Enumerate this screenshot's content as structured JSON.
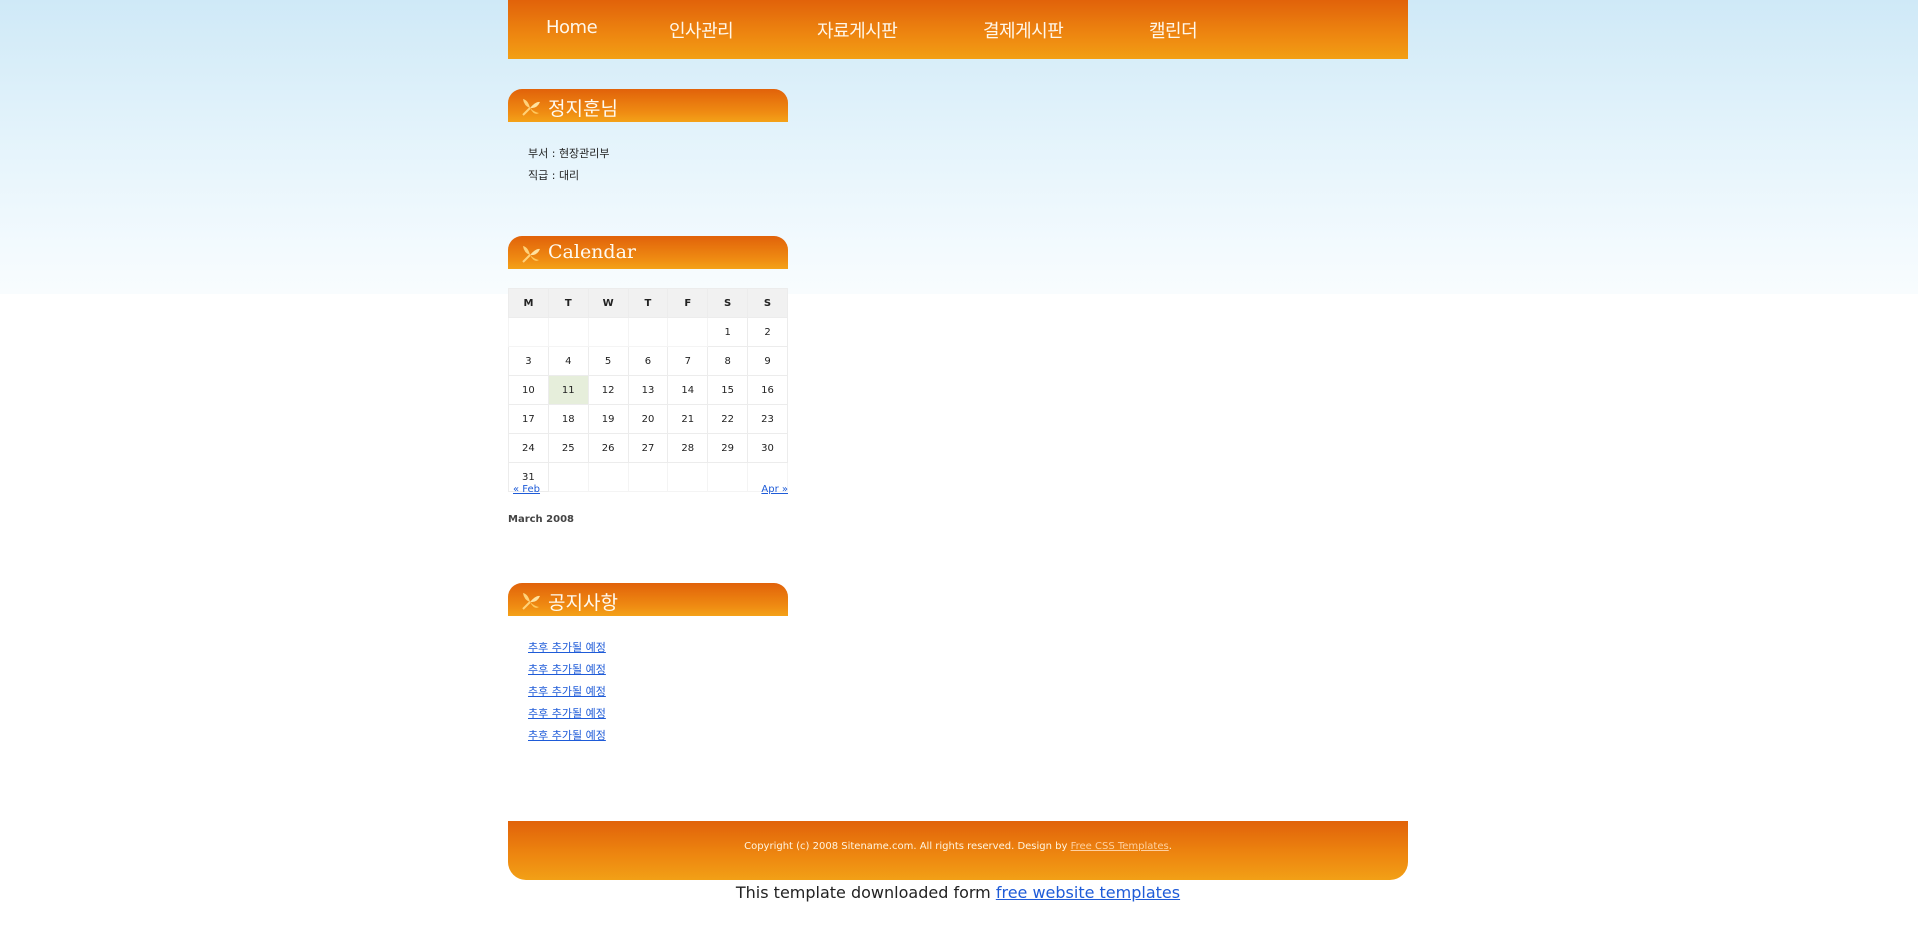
{
  "nav": {
    "items": [
      "Home",
      "인사관리",
      "자료게시판",
      "결제게시판",
      "캘린더"
    ]
  },
  "profile": {
    "title": "정지훈님",
    "department": "부서 : 현장관리부",
    "position": "직급 : 대리"
  },
  "calendar": {
    "title": "Calendar",
    "weekdays": [
      "M",
      "T",
      "W",
      "T",
      "F",
      "S",
      "S"
    ],
    "weeks": [
      [
        "",
        "",
        "",
        "",
        "",
        "1",
        "2"
      ],
      [
        "3",
        "4",
        "5",
        "6",
        "7",
        "8",
        "9"
      ],
      [
        "10",
        "11",
        "12",
        "13",
        "14",
        "15",
        "16"
      ],
      [
        "17",
        "18",
        "19",
        "20",
        "21",
        "22",
        "23"
      ],
      [
        "24",
        "25",
        "26",
        "27",
        "28",
        "29",
        "30"
      ],
      [
        "31",
        "",
        "",
        "",
        "",
        "",
        ""
      ]
    ],
    "highlighted_day": "11",
    "prev_label": "« Feb",
    "next_label": "Apr »",
    "caption": "March 2008"
  },
  "notice": {
    "title": "공지사항",
    "items": [
      "추후 추가될 예정",
      "추후 추가될 예정",
      "추후 추가될 예정",
      "추후 추가될 예정",
      "추후 추가될 예정"
    ]
  },
  "footer": {
    "copyright_prefix": "Copyright (c) 2008 Sitename.com. All rights reserved. Design by ",
    "copyright_link": "Free CSS Templates",
    "copyright_suffix": ".",
    "download_prefix": "This template downloaded form ",
    "download_link": "free website templates"
  },
  "colors": {
    "accent_orange": "#e86f0c",
    "link_blue": "#1e5bd8",
    "sky_blue": "#cfe9f7",
    "today_highlight": "#e6eedb"
  }
}
